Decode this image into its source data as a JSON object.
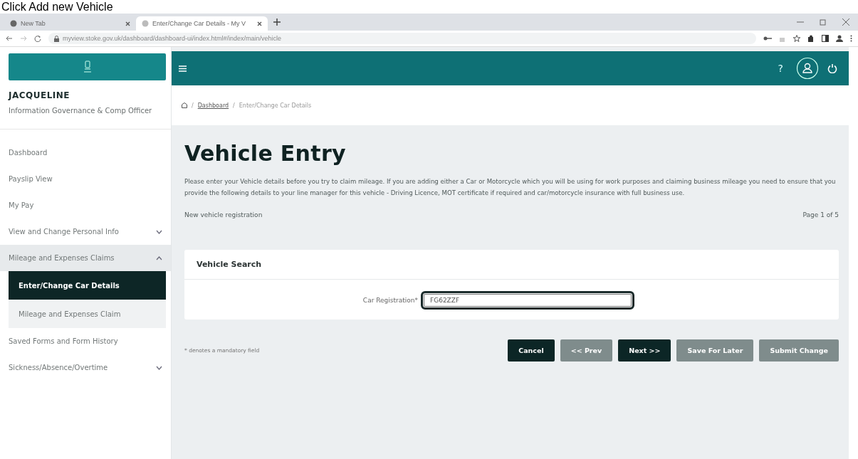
{
  "caption": "Click Add new Vehicle",
  "browser": {
    "tabs": [
      {
        "title": "New Tab",
        "selected": false
      },
      {
        "title": "Enter/Change Car Details - My V",
        "selected": true
      }
    ],
    "url": "myview.stoke.gov.uk/dashboard/dashboard-ui/index.html#/index/main/vehicle"
  },
  "user": {
    "name": "JACQUELINE",
    "role": "Information Governance & Comp Officer"
  },
  "sidebar": {
    "items": [
      {
        "label": "Dashboard",
        "selected": false
      },
      {
        "label": "Payslip View",
        "selected": false
      },
      {
        "label": "My Pay",
        "selected": false
      },
      {
        "label": "View and Change Personal Info",
        "selected": false,
        "expanded": false
      },
      {
        "label": "Mileage and Expenses Claims",
        "selected": false,
        "expanded": true,
        "children": [
          {
            "label": "Enter/Change Car Details",
            "selected": true
          },
          {
            "label": "Mileage and Expenses Claim",
            "selected": false
          }
        ]
      },
      {
        "label": "Saved Forms and Form History",
        "selected": false
      },
      {
        "label": "Sickness/Absence/Overtime",
        "selected": false,
        "expanded": false
      }
    ]
  },
  "topbar": {
    "help": "?"
  },
  "breadcrumb": [
    {
      "separator": "/",
      "label": "Dashboard",
      "kind": "link"
    },
    {
      "separator": "/",
      "label": "Enter/Change Car Details",
      "kind": "current"
    }
  ],
  "page": {
    "title": "Vehicle Entry",
    "description": "Please enter your Vehicle details before you try to claim mileage. If you are adding either a Car or Motorcycle which you will be using for work purposes and claiming business mileage you need to ensure that you provide the following details to your line manager for this vehicle - Driving Licence, MOT certificate if required and car/motorcycle insurance with full business use.",
    "subtitle": "New vehicle registration",
    "page_indicator": "Page 1 of 5"
  },
  "card": {
    "title": "Vehicle Search",
    "field_label": "Car Registration*",
    "field_value": "FG62ZZF"
  },
  "footnote": "* denotes a mandatory field",
  "buttons": [
    {
      "label": "Cancel",
      "disabled": false
    },
    {
      "label": "<< Prev",
      "disabled": true
    },
    {
      "label": "Next >>",
      "disabled": false
    },
    {
      "label": "Save For Later",
      "disabled": true
    },
    {
      "label": "Submit Change",
      "disabled": true
    }
  ]
}
